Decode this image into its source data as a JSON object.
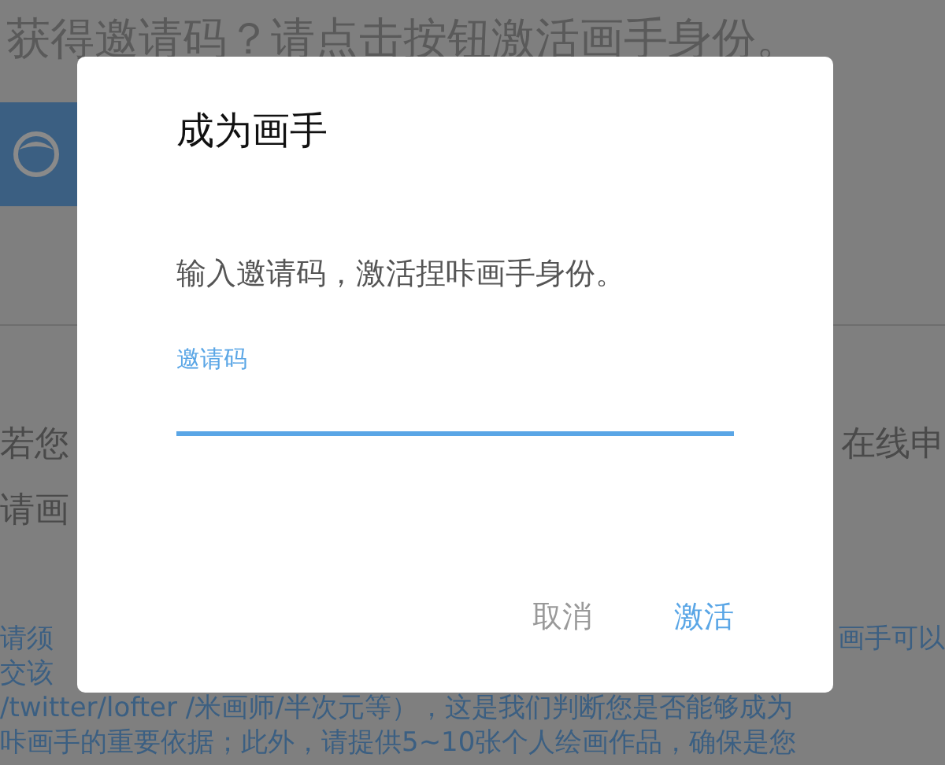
{
  "background": {
    "heading": "获得邀请码？请点击按钮激活画手身份。",
    "intro_lines": [
      {
        "left": "若您",
        "right": "在线申"
      },
      {
        "left": "请画"
      }
    ],
    "notice_lines": [
      {
        "left": "请须",
        "right": "画手可以"
      },
      {
        "left": "交该"
      },
      {
        "left": "/twitter/lofter /米画师/半次元等），这是我们判断您是否能够成为"
      },
      {
        "left": "咔画手的重要依据；此外，请提供5~10张个人绘画作品，确保是您"
      }
    ]
  },
  "dialog": {
    "title": "成为画手",
    "message": "输入邀请码，激活捏咔画手身份。",
    "field": {
      "label": "邀请码"
    },
    "buttons": [
      {
        "label": "取消",
        "kind": "cancel"
      },
      {
        "label": "激活",
        "kind": "confirm"
      }
    ]
  }
}
